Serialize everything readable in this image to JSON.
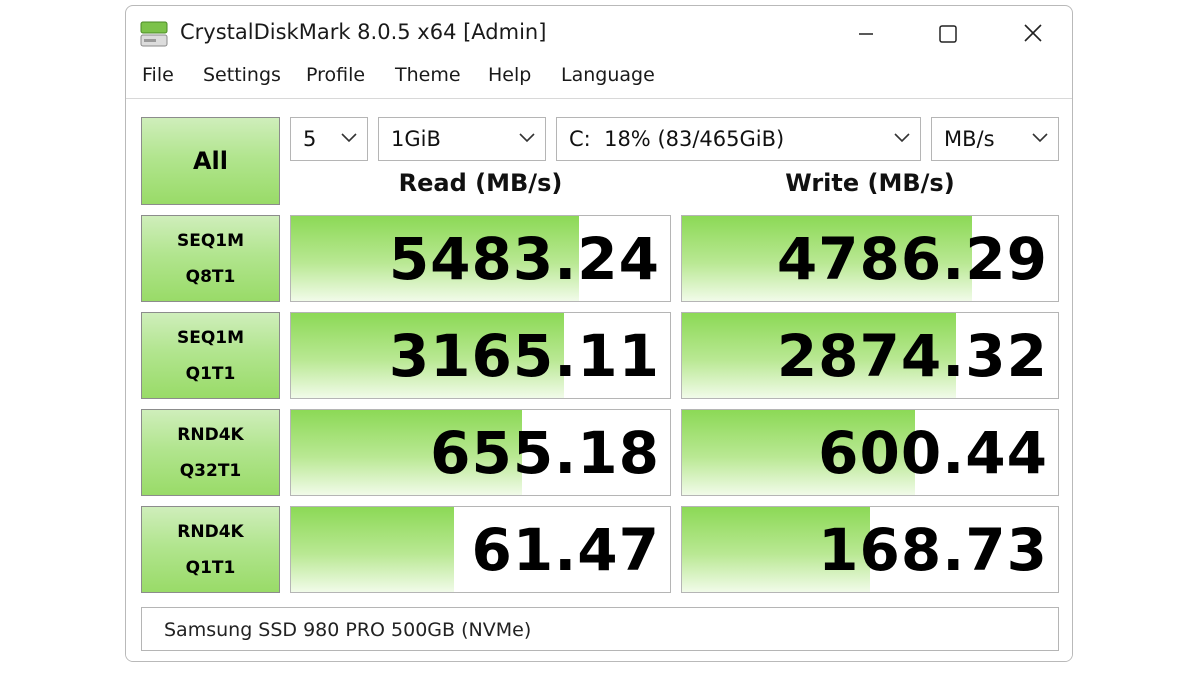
{
  "window": {
    "title": "CrystalDiskMark 8.0.5 x64 [Admin]",
    "icons": [
      "app-disk-icon",
      "minimize-icon",
      "maximize-icon",
      "close-icon"
    ]
  },
  "menu": [
    "File",
    "Settings",
    "Profile",
    "Theme",
    "Help",
    "Language"
  ],
  "controls": {
    "all_label": "All",
    "count": "5",
    "size": "1GiB",
    "drive": "C:  18% (83/465GiB)",
    "unit": "MB/s"
  },
  "headers": {
    "read": "Read (MB/s)",
    "write": "Write (MB/s)"
  },
  "tests": [
    {
      "line1": "SEQ1M",
      "line2": "Q8T1",
      "read": "5483.24",
      "write": "4786.29",
      "read_fill": 0.76,
      "write_fill": 0.77
    },
    {
      "line1": "SEQ1M",
      "line2": "Q1T1",
      "read": "3165.11",
      "write": "2874.32",
      "read_fill": 0.72,
      "write_fill": 0.73
    },
    {
      "line1": "RND4K",
      "line2": "Q32T1",
      "read": "655.18",
      "write": "600.44",
      "read_fill": 0.61,
      "write_fill": 0.62
    },
    {
      "line1": "RND4K",
      "line2": "Q1T1",
      "read": "61.47",
      "write": "168.73",
      "read_fill": 0.43,
      "write_fill": 0.5
    }
  ],
  "status_text": "Samsung SSD 980 PRO 500GB (NVMe)",
  "colors": {
    "bar_green": "#8cd956",
    "button_green": "#b2e58f"
  }
}
